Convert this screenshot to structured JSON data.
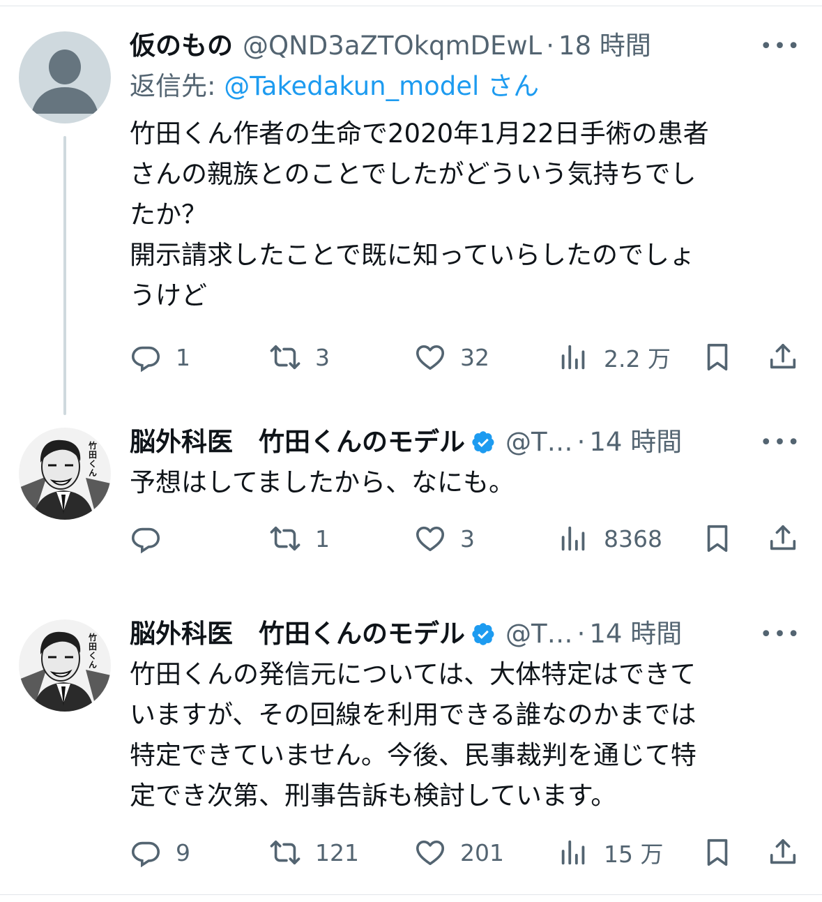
{
  "colors": {
    "text": "#0f1419",
    "secondary": "#536471",
    "link": "#1d9bf0",
    "thread_line": "#cfd9de"
  },
  "tweets": [
    {
      "name": "仮のもの",
      "handle": "@QND3aZTOkqmDEwL",
      "sep": "·",
      "time": "18 時間",
      "more": "•••",
      "reply_prefix": "返信先: ",
      "reply_mention": "@Takedakun_model",
      "reply_suffix": " さん",
      "text": "竹田くん作者の生命で2020年1月22日手術の患者\nさんの親族とのことでしたがどういう気持ちでし\nたか？\n開示請求したことで既に知っていらしたのでしょ\nうけど",
      "avatar_icon": "default-profile-icon",
      "replies": "1",
      "retweets": "3",
      "likes": "32",
      "views": "2.2 万"
    },
    {
      "name": "脳外科医　竹田くんのモデル",
      "verified": true,
      "handle": "@T…",
      "sep": "·",
      "time": "14 時間",
      "more": "•••",
      "text": "予想はしてましたから、なにも。",
      "avatar_icon": "manga-portrait-icon",
      "avatar_caption": "竹田くん",
      "replies": "",
      "retweets": "1",
      "likes": "3",
      "views": "8368"
    },
    {
      "name": "脳外科医　竹田くんのモデル",
      "verified": true,
      "handle": "@T…",
      "sep": "·",
      "time": "14 時間",
      "more": "•••",
      "text": "竹田くんの発信元については、大体特定はできて\nいますが、その回線を利用できる誰なのかまでは\n特定できていません。今後、民事裁判を通じて特\n定でき次第、刑事告訴も検討しています。",
      "avatar_icon": "manga-portrait-icon",
      "avatar_caption": "竹田くん",
      "replies": "9",
      "retweets": "121",
      "likes": "201",
      "views": "15 万"
    }
  ]
}
